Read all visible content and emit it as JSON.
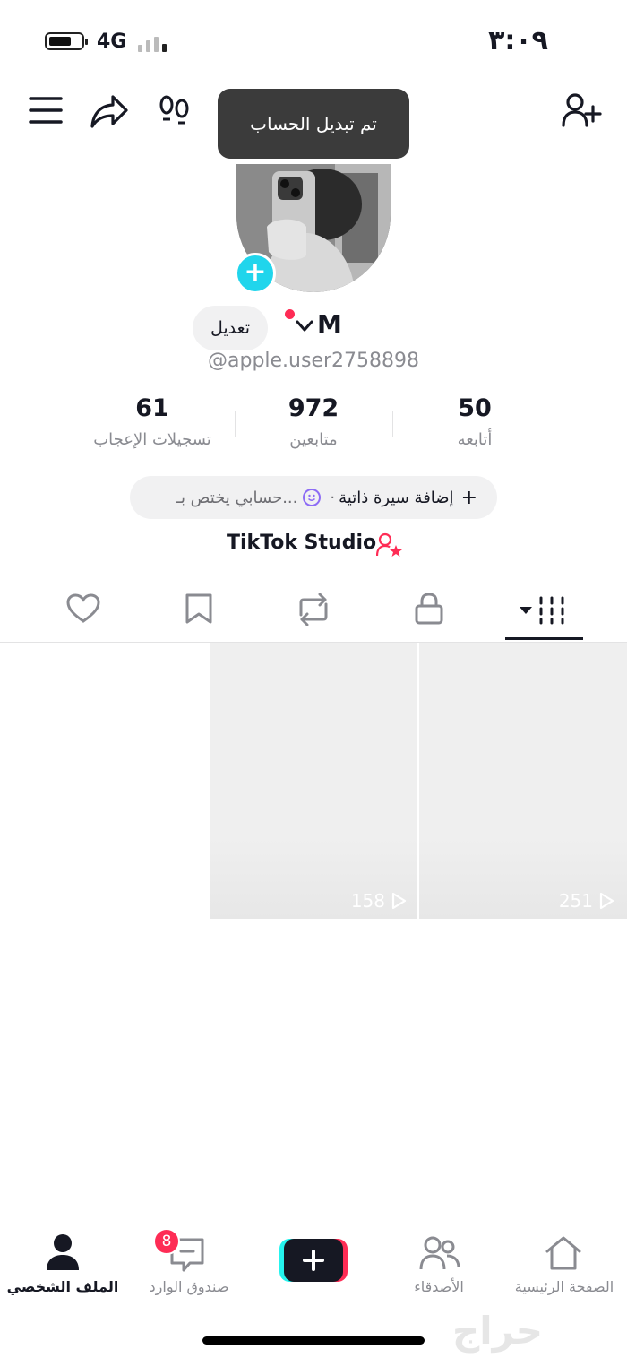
{
  "status_bar": {
    "time": "٣:٠٩",
    "network": "4G"
  },
  "top_bar": {
    "icons": [
      "menu-icon",
      "share-icon",
      "footprints-icon",
      "add-friend-icon"
    ],
    "toast": "تم تبديل الحساب"
  },
  "profile": {
    "name": "M",
    "handle": "@apple.user2758898",
    "edit_label": "تعديل",
    "stats": [
      {
        "value": "61",
        "label": "تسجيلات الإعجاب"
      },
      {
        "value": "972",
        "label": "متابعين"
      },
      {
        "value": "50",
        "label": "أتابعه"
      }
    ],
    "bio_add": "إضافة سيرة ذاتية",
    "bio_sep": "·",
    "bio_hint": "حسابي يختص بـ...",
    "studio_label": "TikTok Studio"
  },
  "content_tabs": [
    "liked-tab",
    "favorites-tab",
    "reposts-tab",
    "private-tab",
    "videos-tab"
  ],
  "videos": [
    {
      "views": "251"
    },
    {
      "views": "158"
    }
  ],
  "bottom_nav": {
    "home": "الصفحة الرئيسية",
    "friends": "الأصدقاء",
    "inbox": "صندوق الوارد",
    "inbox_badge": "8",
    "profile": "الملف الشخصي"
  },
  "watermark": "حراج",
  "colors": {
    "accent": "#fe2c55",
    "cyan": "#20d5ec",
    "text": "#161823",
    "muted": "#8a8b91"
  }
}
